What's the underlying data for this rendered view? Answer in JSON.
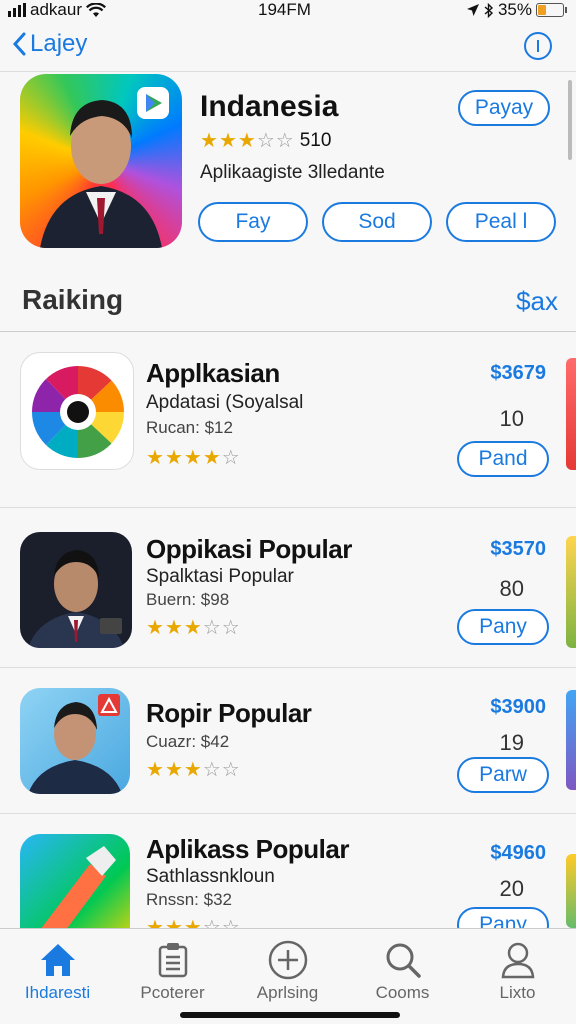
{
  "status": {
    "carrier": "adkaur",
    "time": "194FM",
    "battery": "35%",
    "battery_level": 0.35
  },
  "nav": {
    "back_label": "Lajey"
  },
  "featured": {
    "title": "Indanesia",
    "rating_value": "510",
    "stars": 3,
    "subtitle": "Aplikaagiste 3lledante",
    "top_button": "Payay",
    "buttons": [
      "Fay",
      "Sod",
      "Peal l"
    ]
  },
  "section": {
    "title": "Raiking",
    "action": "$ax"
  },
  "apps": [
    {
      "title": "Applkasian",
      "subtitle": "Apdatasi (Soyalsal",
      "meta": "Rucan: $12",
      "stars": 4,
      "price": "$3679",
      "count": "10",
      "button": "Pand"
    },
    {
      "title": "Oppikasi Popular",
      "subtitle": "Spalktasi Popular",
      "meta": "Buern: $98",
      "stars": 3,
      "price": "$3570",
      "count": "80",
      "button": "Pany"
    },
    {
      "title": "Ropir Popular",
      "subtitle": "",
      "meta": "Cuazr: $42",
      "stars": 3,
      "price": "$3900",
      "count": "19",
      "button": "Parw"
    },
    {
      "title": "Aplikass Popular",
      "subtitle": "Sathlassnkloun",
      "meta": "Rnssn: $32",
      "stars": 3,
      "price": "$4960",
      "count": "20",
      "button": "Pany"
    }
  ],
  "tabs": [
    {
      "label": "Ihdaresti",
      "icon": "home-icon",
      "active": true
    },
    {
      "label": "Pcoterer",
      "icon": "clipboard-icon",
      "active": false
    },
    {
      "label": "Aprlsing",
      "icon": "plus-circle-icon",
      "active": false
    },
    {
      "label": "Cooms",
      "icon": "search-icon",
      "active": false
    },
    {
      "label": "Lixto",
      "icon": "person-icon",
      "active": false
    }
  ],
  "colors": {
    "accent": "#1a7ae0",
    "star": "#e9a800"
  }
}
